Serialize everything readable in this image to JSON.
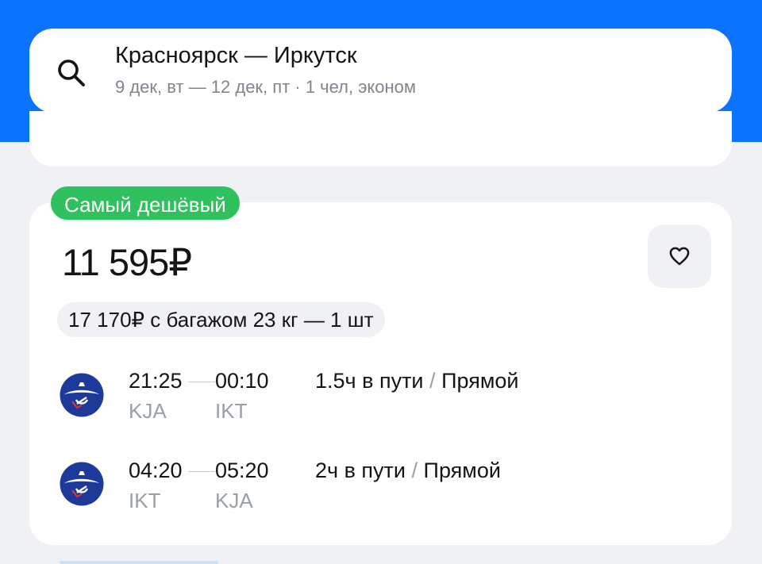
{
  "search": {
    "route": "Красноярск — Иркутск",
    "details": "9 дек, вт — 12 дек, пт · 1 чел, эконом"
  },
  "offer": {
    "badge": "Самый дешёвый",
    "price": "11 595₽",
    "baggage": "17 170₽ с багажом 23 кг — 1 шт",
    "segments": [
      {
        "depart_time": "21:25",
        "arrive_time": "00:10",
        "from": "KJA",
        "to": "IKT",
        "duration": "1.5ч в пути",
        "separator": "/",
        "type": "Прямой",
        "airline_icon": "aeroflot-logo-icon"
      },
      {
        "depart_time": "04:20",
        "arrive_time": "05:20",
        "from": "IKT",
        "to": "KJA",
        "duration": "2ч в пути",
        "separator": "/",
        "type": "Прямой",
        "airline_icon": "aeroflot-logo-icon"
      }
    ]
  },
  "colors": {
    "header_bg": "#0c73fe",
    "badge_bg": "#2fc15d",
    "page_bg": "#eff1f4",
    "logo_blue": "#1d3a9b"
  }
}
